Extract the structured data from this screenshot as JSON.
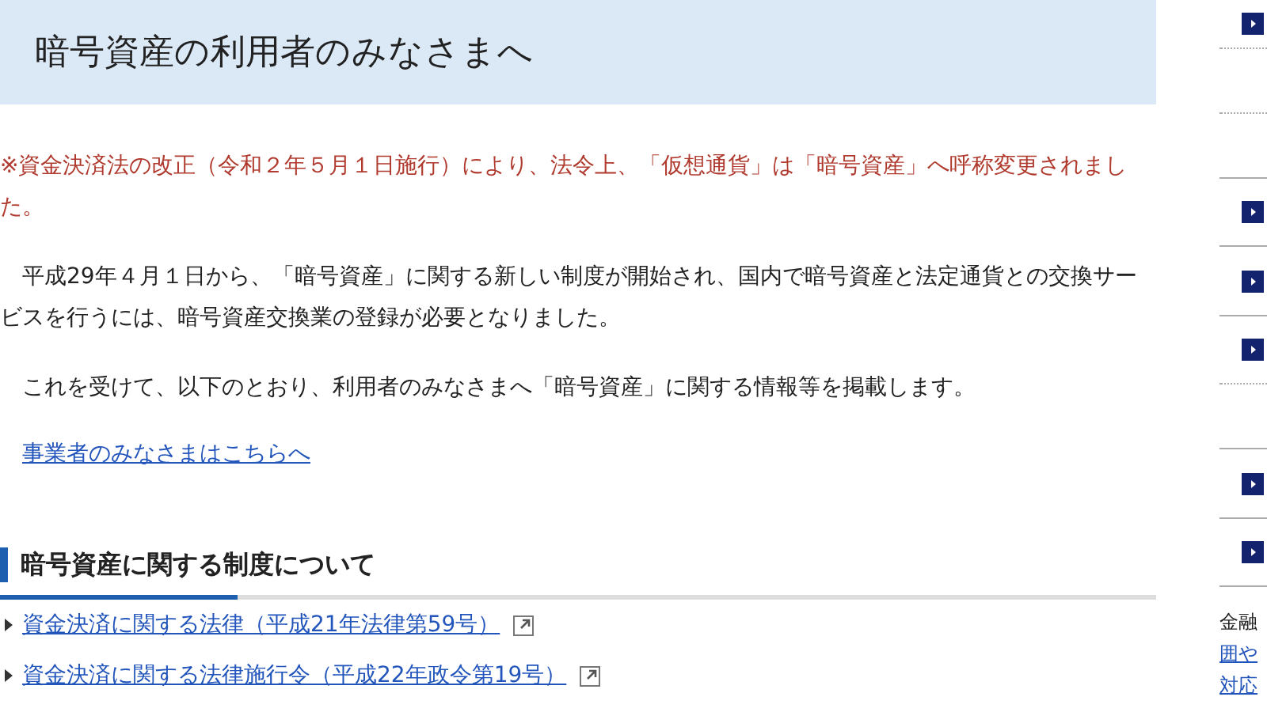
{
  "header": {
    "title": "暗号資産の利用者のみなさまへ"
  },
  "notice": "※資金決済法の改正（令和２年５月１日施行）により、法令上、「仮想通貨」は「暗号資産」へ呼称変更されました。",
  "paragraphs": [
    "平成29年４月１日から、「暗号資産」に関する新しい制度が開始され、国内で暗号資産と法定通貨との交換サービスを行うには、暗号資産交換業の登録が必要となりました。",
    "これを受けて、以下のとおり、利用者のみなさまへ「暗号資産」に関する情報等を掲載します。"
  ],
  "operator_link": "事業者のみなさまはこちらへ",
  "section": {
    "heading": "暗号資産に関する制度について",
    "links": [
      {
        "text": "資金決済に関する法律（平成21年法律第59号）",
        "external": true
      },
      {
        "text": "資金決済に関する法律施行令（平成22年政令第19号）",
        "external": true
      }
    ]
  },
  "sidebar": {
    "note_line": "金融",
    "note_link": "囲や",
    "note_link_2": "対応"
  }
}
